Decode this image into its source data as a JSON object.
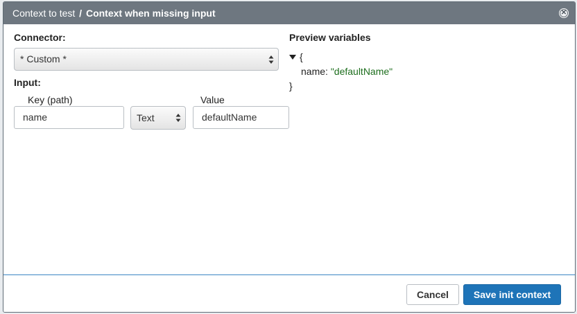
{
  "dialog": {
    "breadcrumb": "Context to test",
    "separator": "/",
    "title": "Context when missing input",
    "close_icon": "close-icon"
  },
  "connector": {
    "label": "Connector:",
    "selected": "* Custom *"
  },
  "input": {
    "label": "Input:",
    "columns": {
      "key": "Key (path)",
      "value": "Value"
    },
    "rows": [
      {
        "key": "name",
        "type": "Text",
        "value": "defaultName"
      }
    ]
  },
  "preview": {
    "label": "Preview variables",
    "open_brace": "{",
    "close_brace": "}",
    "entries": [
      {
        "key": "name:",
        "value": "\"defaultName\""
      }
    ]
  },
  "footer": {
    "cancel_label": "Cancel",
    "save_label": "Save init context"
  },
  "colors": {
    "titlebar": "#6e7780",
    "primary": "#1e74b8",
    "string_value": "#1d6e1d"
  }
}
